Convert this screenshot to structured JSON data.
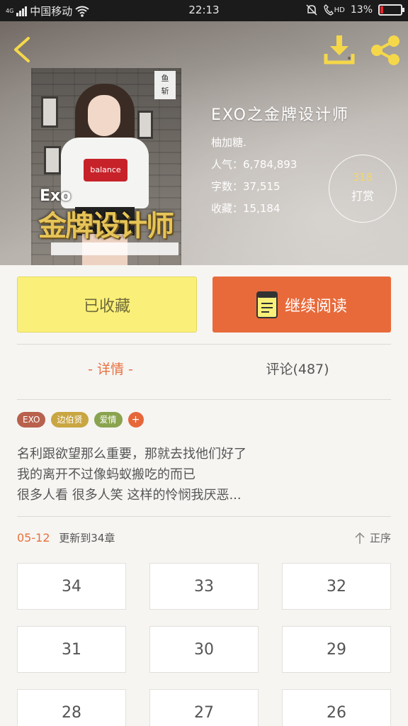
{
  "status_bar": {
    "network_small": "4G",
    "carrier": "中国移动",
    "time": "22:13",
    "hd_label": "HD",
    "battery_text": "13%",
    "battery_level": 0.13,
    "icons": [
      "signal-icon",
      "wifi-icon",
      "silent-icon",
      "hd-call-icon",
      "battery-icon"
    ]
  },
  "header": {
    "back_icon": "chevron-left-icon",
    "download_icon": "download-icon",
    "share_icon": "share-icon"
  },
  "book": {
    "title": "EXO之金牌设计师",
    "author": "柚加糖.",
    "popularity_label": "人气：",
    "popularity": "6,784,893",
    "words_label": "字数：",
    "words": "37,515",
    "favorites_label": "收藏：",
    "favorites": "15,184",
    "cover": {
      "corner_tag": "鱼\n斩",
      "brand_text": "Exo",
      "cover_title": "金牌设计师"
    }
  },
  "tip": {
    "count": "318",
    "label": "打赏"
  },
  "actions": {
    "favorite_label": "已收藏",
    "read_label": "继续阅读",
    "read_icon": "book-icon"
  },
  "tabs": {
    "details": "-  详情  -",
    "comments": "评论(487)"
  },
  "tags": [
    {
      "label": "EXO",
      "color": "#b8614d"
    },
    {
      "label": "边伯贤",
      "color": "#c9a642"
    },
    {
      "label": "爱情",
      "color": "#8aa34f"
    }
  ],
  "tag_add": "+",
  "synopsis": [
    "名利跟欲望那么重要，那就去找他们好了",
    "我的离开不过像蚂蚁搬吃的而已",
    "很多人看  很多人笑  这样的怜悯我厌恶..."
  ],
  "update": {
    "date": "05-12",
    "text": "更新到34章",
    "sort_label": "正序",
    "sort_icon": "arrow-up-icon"
  },
  "chapters": [
    "34",
    "33",
    "32",
    "31",
    "30",
    "29",
    "28",
    "27",
    "26"
  ],
  "colors": {
    "accent": "#e8703f",
    "favorite_bg": "#faf079",
    "read_bg": "#e86a3a",
    "tip_gold": "#f3d66a"
  }
}
